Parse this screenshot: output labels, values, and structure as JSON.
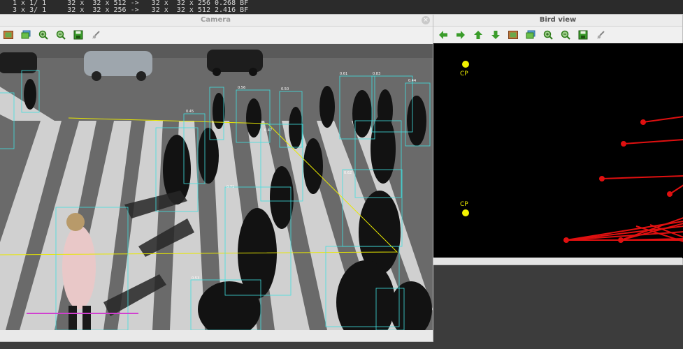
{
  "terminal": {
    "lines": [
      "1 x 1/ 1     32 x  32 x 512 ->   32 x  32 x 256 0.268 BF",
      "3 x 3/ 1     32 x  32 x 256 ->   32 x  32 x 512 2.416 BF"
    ]
  },
  "camera_window": {
    "title": "Camera",
    "close_glyph": "×",
    "detection_labels": [
      "0.61",
      "0.83",
      "0.44",
      "0.50",
      "0.56",
      "0.47",
      "0.45",
      "0.62",
      "0.71",
      "0.53"
    ]
  },
  "bird_window": {
    "title": "Bird view",
    "cp_labels": [
      "CP",
      "CP"
    ]
  },
  "toolbar": {
    "icons": [
      "arrow-left-icon",
      "arrow-right-icon",
      "arrow-up-icon",
      "arrow-down-icon",
      "image-icon",
      "image-stack-icon",
      "zoom-in-icon",
      "zoom-out-icon",
      "save-icon",
      "brush-icon"
    ]
  },
  "colors": {
    "toolbar_green": "#3a9c2a",
    "cp_yellow": "#f2f200",
    "bird_line_red": "#e01010",
    "bbox_cyan": "#40e0e0",
    "roi_yellow": "#e8e800"
  }
}
